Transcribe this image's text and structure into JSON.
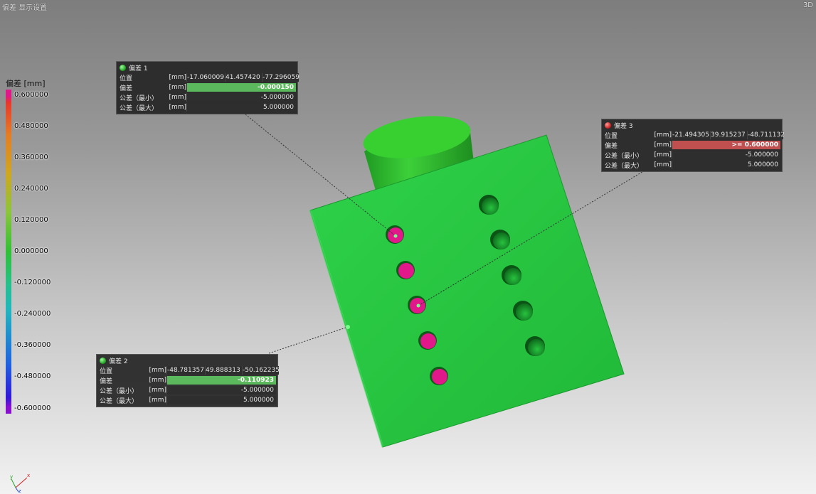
{
  "window": {
    "title": "偏差 显示设置",
    "corner_label": "3D"
  },
  "legend": {
    "title": "偏差 [mm]",
    "labels": [
      "0.600000",
      "0.480000",
      "0.360000",
      "0.240000",
      "0.120000",
      "0.000000",
      "-0.120000",
      "-0.240000",
      "-0.360000",
      "-0.480000",
      "-0.600000"
    ]
  },
  "annotations": [
    {
      "title": "偏差 1",
      "status": "green",
      "position_label": "位置",
      "position_unit": "[mm]",
      "x": "-17.060009",
      "y": "41.457420",
      "z": "-77.296059",
      "deviation_label": "偏差",
      "deviation_unit": "[mm]",
      "deviation": "-0.000150",
      "tol_min_label": "公差（最小）",
      "tol_min_unit": "[mm]",
      "tol_min": "-5.000000",
      "tol_max_label": "公差（最大）",
      "tol_max_unit": "[mm]",
      "tol_max": "5.000000"
    },
    {
      "title": "偏差 2",
      "status": "green",
      "position_label": "位置",
      "position_unit": "[mm]",
      "x": "-48.781357",
      "y": "49.888313",
      "z": "-50.162235",
      "deviation_label": "偏差",
      "deviation_unit": "[mm]",
      "deviation": "-0.110923",
      "tol_min_label": "公差（最小）",
      "tol_min_unit": "[mm]",
      "tol_min": "-5.000000",
      "tol_max_label": "公差（最大）",
      "tol_max_unit": "[mm]",
      "tol_max": "5.000000"
    },
    {
      "title": "偏差 3",
      "status": "red",
      "position_label": "位置",
      "position_unit": "[mm]",
      "x": "-21.494305",
      "y": "39.915237",
      "z": "-48.711132",
      "deviation_label": "偏差",
      "deviation_unit": "[mm]",
      "deviation": ">= 0.600000",
      "tol_min_label": "公差（最小）",
      "tol_min_unit": "[mm]",
      "tol_min": "-5.000000",
      "tol_max_label": "公差（最大）",
      "tol_max_unit": "[mm]",
      "tol_max": "5.000000"
    }
  ],
  "axes": {
    "x": "x",
    "y": "y",
    "z": "z"
  },
  "colors": {
    "model": "#2ecc40",
    "hole_deviation": "#e0188a",
    "ok": "#5cb85c",
    "fail": "#c05050"
  }
}
